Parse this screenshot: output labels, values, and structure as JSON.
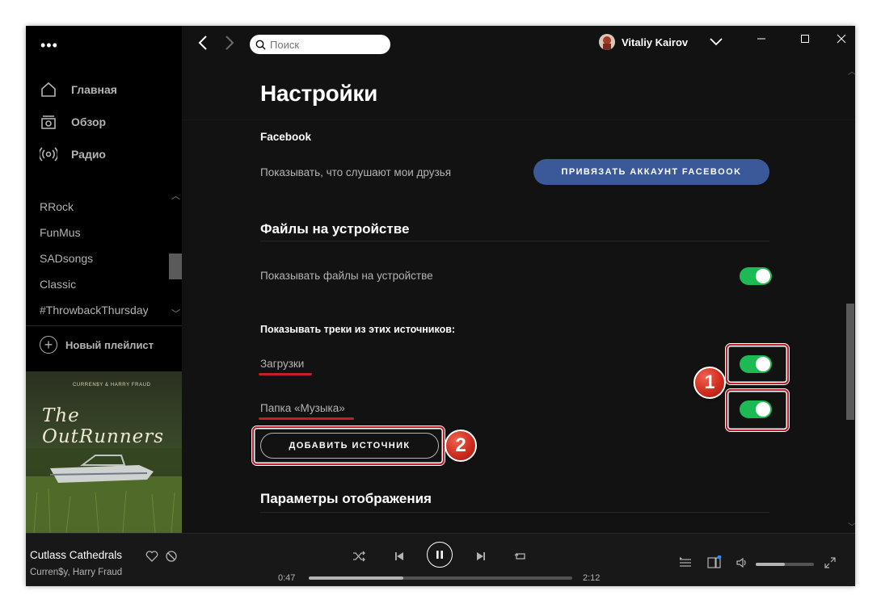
{
  "sidebar": {
    "nav": [
      {
        "label": "Главная",
        "icon": "home-icon"
      },
      {
        "label": "Обзор",
        "icon": "browse-icon"
      },
      {
        "label": "Радио",
        "icon": "radio-icon"
      }
    ],
    "playlists": [
      "RRock",
      "FunMus",
      "SADsongs",
      "Classic",
      "#ThrowbackThursday"
    ],
    "new_playlist_label": "Новый плейлист",
    "cover": {
      "credit": "CURREN$Y & HARRY FRAUD",
      "title": "The OutRunners"
    }
  },
  "topbar": {
    "search_placeholder": "Поиск",
    "user_name": "Vitaliy Kairov"
  },
  "settings": {
    "page_title": "Настройки",
    "facebook": {
      "section_label": "Facebook",
      "row_label": "Показывать, что слушают мои друзья",
      "button_label": "ПРИВЯЗАТЬ АККАУНТ FACEBOOK"
    },
    "local_files": {
      "section_title": "Файлы на устройстве",
      "show_files_label": "Показывать файлы на устройстве",
      "show_files_on": true,
      "sources_heading": "Показывать треки из этих источников:",
      "sources": [
        {
          "label": "Загрузки",
          "on": true
        },
        {
          "label": "Папка «Музыка»",
          "on": true
        }
      ],
      "add_source_label": "ДОБАВИТЬ ИСТОЧНИК"
    },
    "display": {
      "section_title": "Параметры отображения"
    }
  },
  "annotations": {
    "badge_1": "1",
    "badge_2": "2",
    "color": "#c41e2a"
  },
  "player": {
    "track_title": "Cutlass Cathedrals",
    "track_artist": "Curren$y, Harry Fraud",
    "elapsed": "0:47",
    "duration": "2:12",
    "progress_fraction": 0.36,
    "volume_fraction": 0.5
  },
  "colors": {
    "accent_green": "#1db954",
    "facebook_blue": "#3b5998",
    "background": "#121212"
  }
}
